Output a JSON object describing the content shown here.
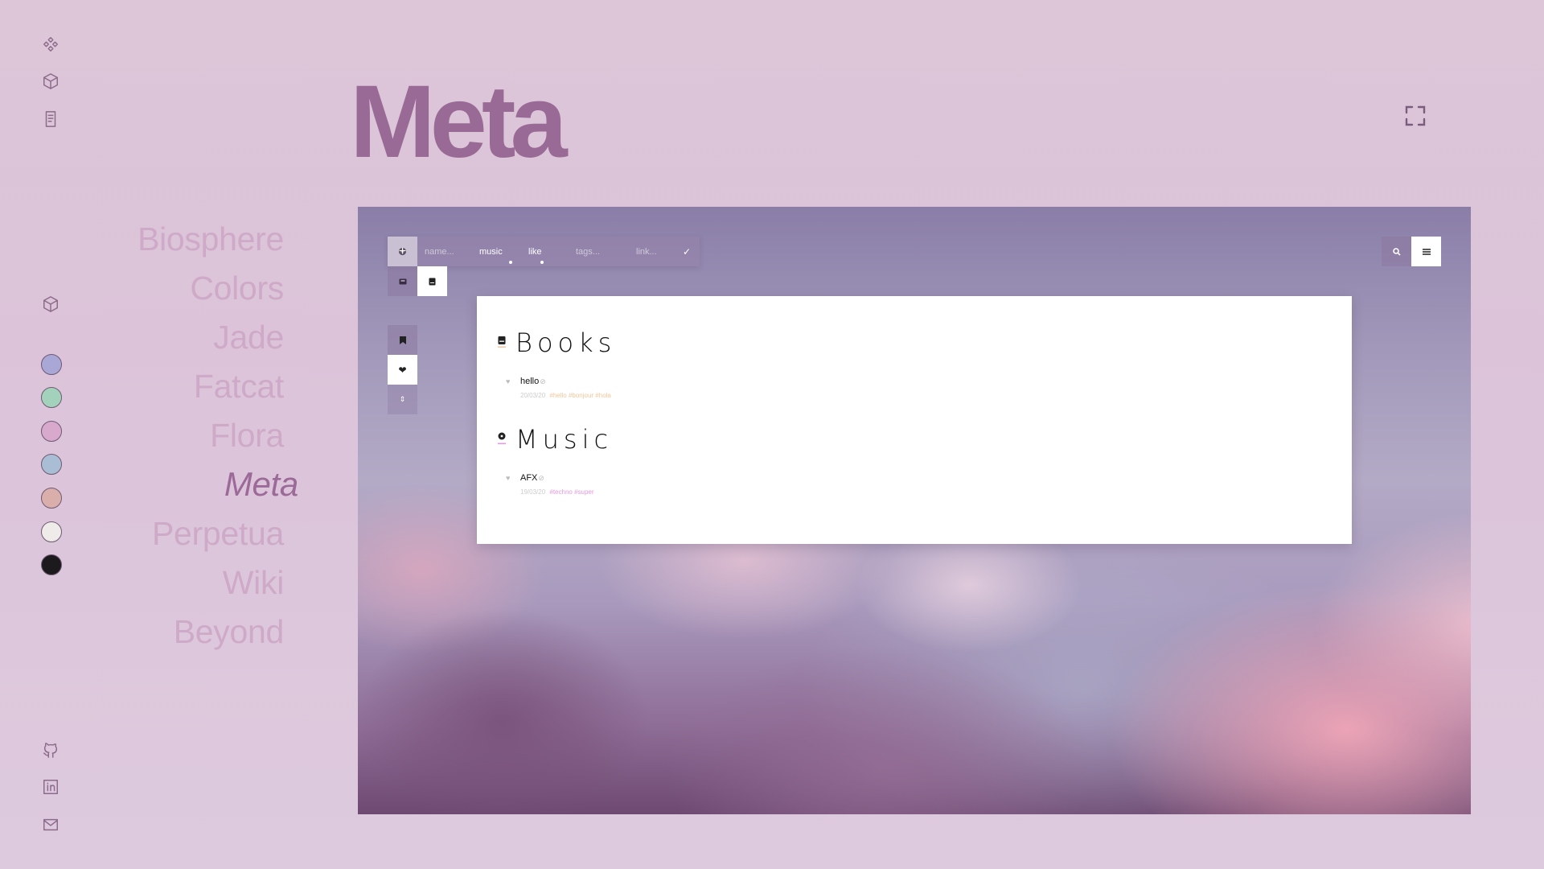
{
  "page": {
    "title": "Meta"
  },
  "nav": {
    "items": [
      "Biosphere",
      "Colors",
      "Jade",
      "Fatcat",
      "Flora",
      "Meta",
      "Perpetua",
      "Wiki",
      "Beyond"
    ],
    "active": "Meta"
  },
  "rail": {
    "top_icons": [
      "apps-icon",
      "cube-icon",
      "document-icon"
    ],
    "mid_icon": "cube-icon",
    "swatches": [
      "#a9a7d6",
      "#a3d2bc",
      "#d8a9cd",
      "#a9bdd5",
      "#d9aeab",
      "#eeebe8",
      "#1c1a1c"
    ],
    "bottom_icons": [
      "github-icon",
      "linkedin-icon",
      "mail-icon"
    ]
  },
  "app": {
    "toolbar": {
      "name_placeholder": "name...",
      "category_value": "music",
      "like_value": "like",
      "tags_placeholder": "tags...",
      "link_placeholder": "link..."
    },
    "sections": [
      {
        "title": "Books",
        "icon": "book-icon",
        "accent": "#f2c79a",
        "entries": [
          {
            "name": "hello",
            "date": "20/03/20",
            "tags": "#hello #bonjour #hola"
          }
        ]
      },
      {
        "title": "Music",
        "icon": "disc-icon",
        "accent": "#e59ae0",
        "entries": [
          {
            "name": "AFX",
            "date": "19/03/20",
            "tags": "#techno #super"
          }
        ]
      }
    ]
  }
}
